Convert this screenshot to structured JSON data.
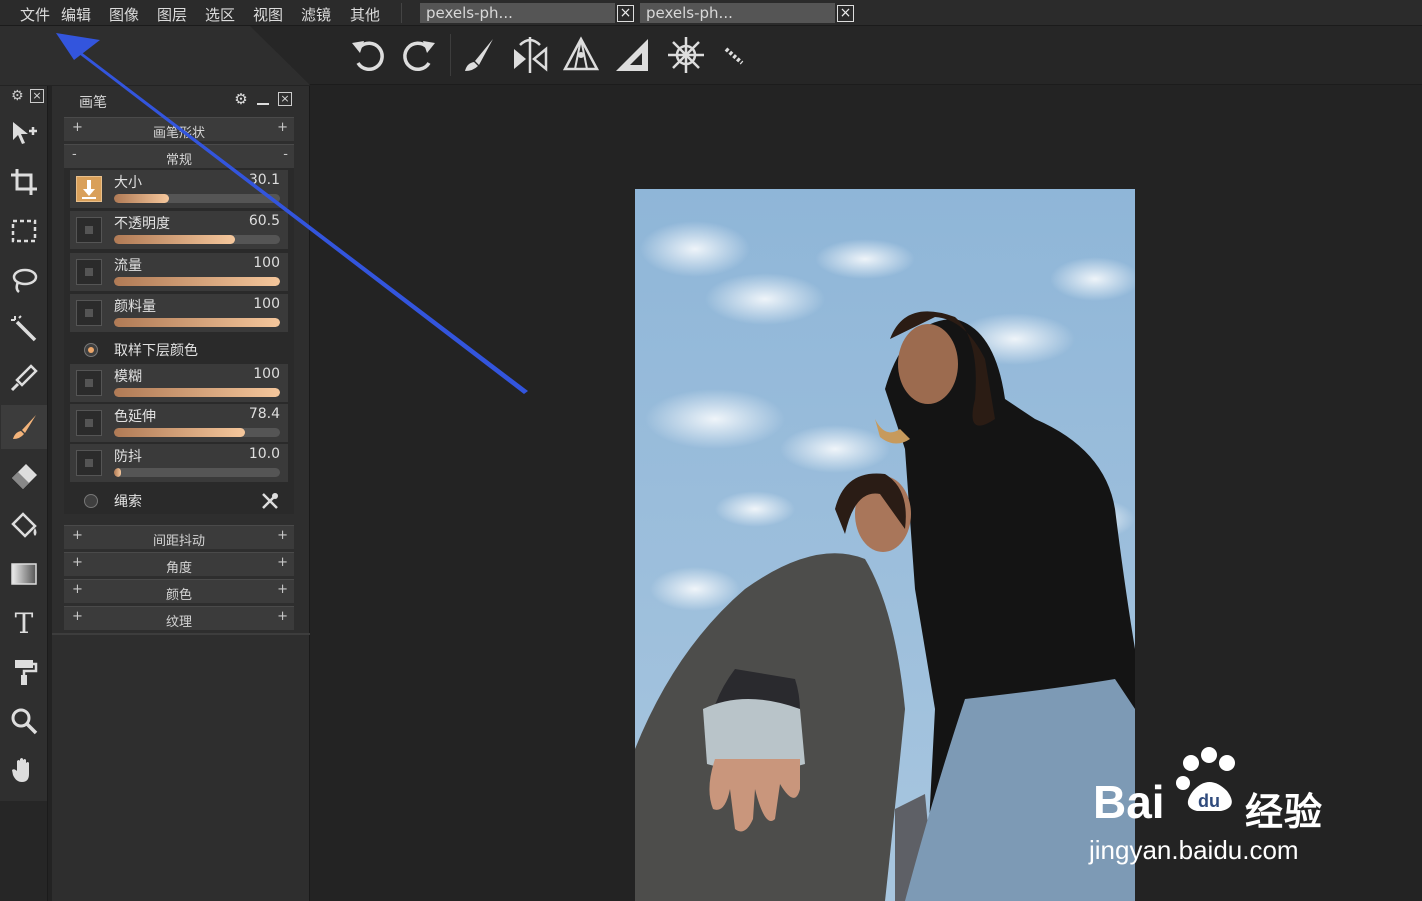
{
  "menubar": {
    "items": [
      "文件",
      "编辑",
      "图像",
      "图层",
      "选区",
      "视图",
      "滤镜",
      "其他"
    ]
  },
  "tabs": [
    {
      "label": "pexels-ph..."
    },
    {
      "label": "pexels-ph..."
    }
  ],
  "toolbar": {
    "icons": [
      "undo-icon",
      "redo-icon",
      "brush-icon",
      "symmetry-icon",
      "perspective-icon",
      "ruler-icon",
      "mandala-icon",
      "line-icon"
    ]
  },
  "tools": [
    "move-icon",
    "crop-icon",
    "rect-select-icon",
    "lasso-icon",
    "magic-wand-icon",
    "eyedropper-icon",
    "brush-icon",
    "eraser-icon",
    "bucket-icon",
    "gradient-icon",
    "text-icon",
    "paint-roller-icon",
    "zoom-icon",
    "hand-icon"
  ],
  "panel": {
    "title": "画笔",
    "sections_top": [
      {
        "label": "画笔形状",
        "mark": "+"
      },
      {
        "label": "常规",
        "mark": "-"
      }
    ],
    "properties": [
      {
        "label": "大小",
        "value": "30.1",
        "fraction": 0.33
      },
      {
        "label": "不透明度",
        "value": "60.5",
        "fraction": 0.73
      },
      {
        "label": "流量",
        "value": "100",
        "fraction": 1.0
      },
      {
        "label": "颜料量",
        "value": "100",
        "fraction": 1.0
      },
      {
        "label": "模糊",
        "value": "100",
        "fraction": 1.0
      },
      {
        "label": "色延伸",
        "value": "78.4",
        "fraction": 0.79
      },
      {
        "label": "防抖",
        "value": "10.0",
        "fraction": 0.04
      }
    ],
    "options": [
      {
        "label": "取样下层颜色",
        "checked": true
      },
      {
        "label": "绳索",
        "checked": false
      }
    ],
    "sections_bottom": [
      {
        "label": "间距抖动",
        "mark": "+"
      },
      {
        "label": "角度",
        "mark": "+"
      },
      {
        "label": "颜色",
        "mark": "+"
      },
      {
        "label": "纹理",
        "mark": "+"
      }
    ]
  },
  "watermark": {
    "line1": "Bai",
    "line1b": "经验",
    "line2": "jingyan.baidu.com"
  },
  "colors": {
    "accent": "#eba66a",
    "annotation_arrow": "#3355dd",
    "sky": "#8fb6d8"
  }
}
